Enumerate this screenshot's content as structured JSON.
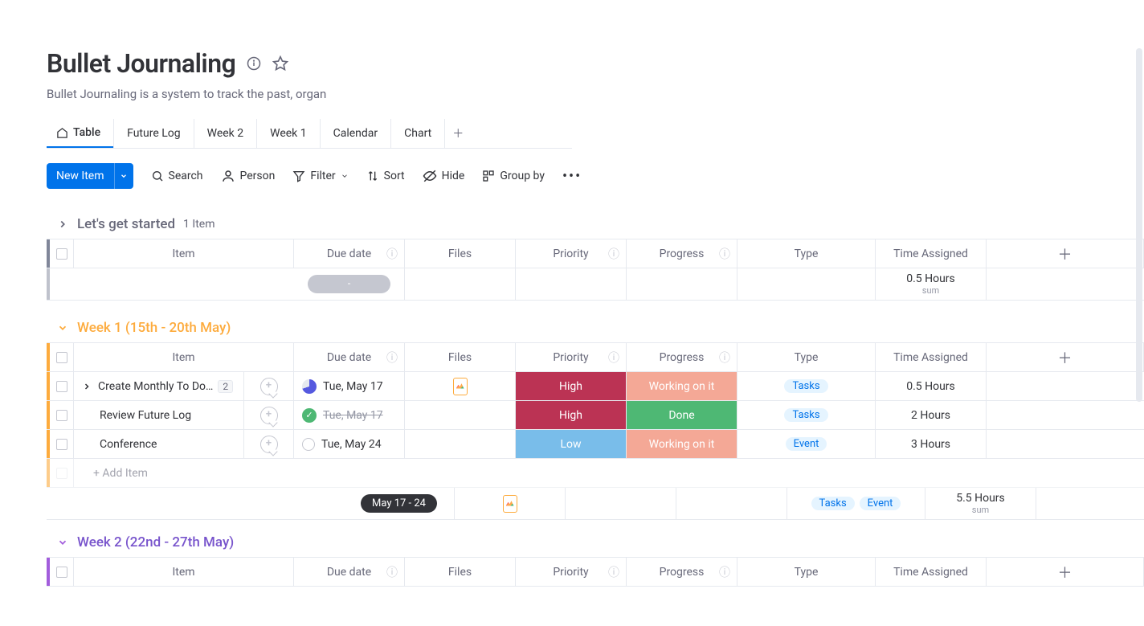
{
  "header": {
    "title": "Bullet Journaling",
    "subtitle": "Bullet Journaling is a system to track the past, organ"
  },
  "tabs": {
    "items": [
      {
        "label": "Table",
        "active": true,
        "icon": "home"
      },
      {
        "label": "Future Log"
      },
      {
        "label": "Week 2"
      },
      {
        "label": "Week 1"
      },
      {
        "label": "Calendar"
      },
      {
        "label": "Chart"
      }
    ]
  },
  "toolbar": {
    "new_item": "New Item",
    "search": "Search",
    "person": "Person",
    "filter": "Filter",
    "sort": "Sort",
    "hide": "Hide",
    "group_by": "Group by"
  },
  "columns": {
    "item": "Item",
    "due_date": "Due date",
    "files": "Files",
    "priority": "Priority",
    "progress": "Progress",
    "type": "Type",
    "time_assigned": "Time Assigned"
  },
  "groups": [
    {
      "id": "g0",
      "color": "#676879",
      "title": "Let's get started",
      "count": "1 Item",
      "collapsed": true,
      "summary": {
        "time": "0.5 Hours",
        "time_sub": "sum",
        "date_pill": "-"
      }
    },
    {
      "id": "g1",
      "color": "#fdab3d",
      "title": "Week 1 (15th - 20th May)",
      "rows": [
        {
          "name": "Create Monthly To Do…",
          "sub_count": "2",
          "expand": true,
          "status_icon": "pie",
          "date": "Tue, May 17",
          "file": true,
          "priority": "High",
          "priority_class": "st-high",
          "progress": "Working on it",
          "progress_class": "st-working",
          "type_tags": [
            "Tasks"
          ],
          "time": "0.5 Hours"
        },
        {
          "name": "Review Future Log",
          "status_icon": "done",
          "date": "Tue, May 17",
          "date_strike": true,
          "priority": "High",
          "priority_class": "st-high",
          "progress": "Done",
          "progress_class": "st-done",
          "type_tags": [
            "Tasks"
          ],
          "time": "2 Hours"
        },
        {
          "name": "Conference",
          "status_icon": "empty",
          "date": "Tue, May 24",
          "priority": "Low",
          "priority_class": "st-low",
          "progress": "Working on it",
          "progress_class": "st-working",
          "type_tags": [
            "Event"
          ],
          "time": "3 Hours"
        }
      ],
      "add_item": "+ Add Item",
      "summary": {
        "date_pill": "May 17 - 24",
        "file": true,
        "type_tags": [
          "Tasks",
          "Event"
        ],
        "time": "5.5 Hours",
        "time_sub": "sum"
      }
    },
    {
      "id": "g2",
      "color": "#a25ddc",
      "title": "Week 2 (22nd - 27th May)"
    }
  ]
}
